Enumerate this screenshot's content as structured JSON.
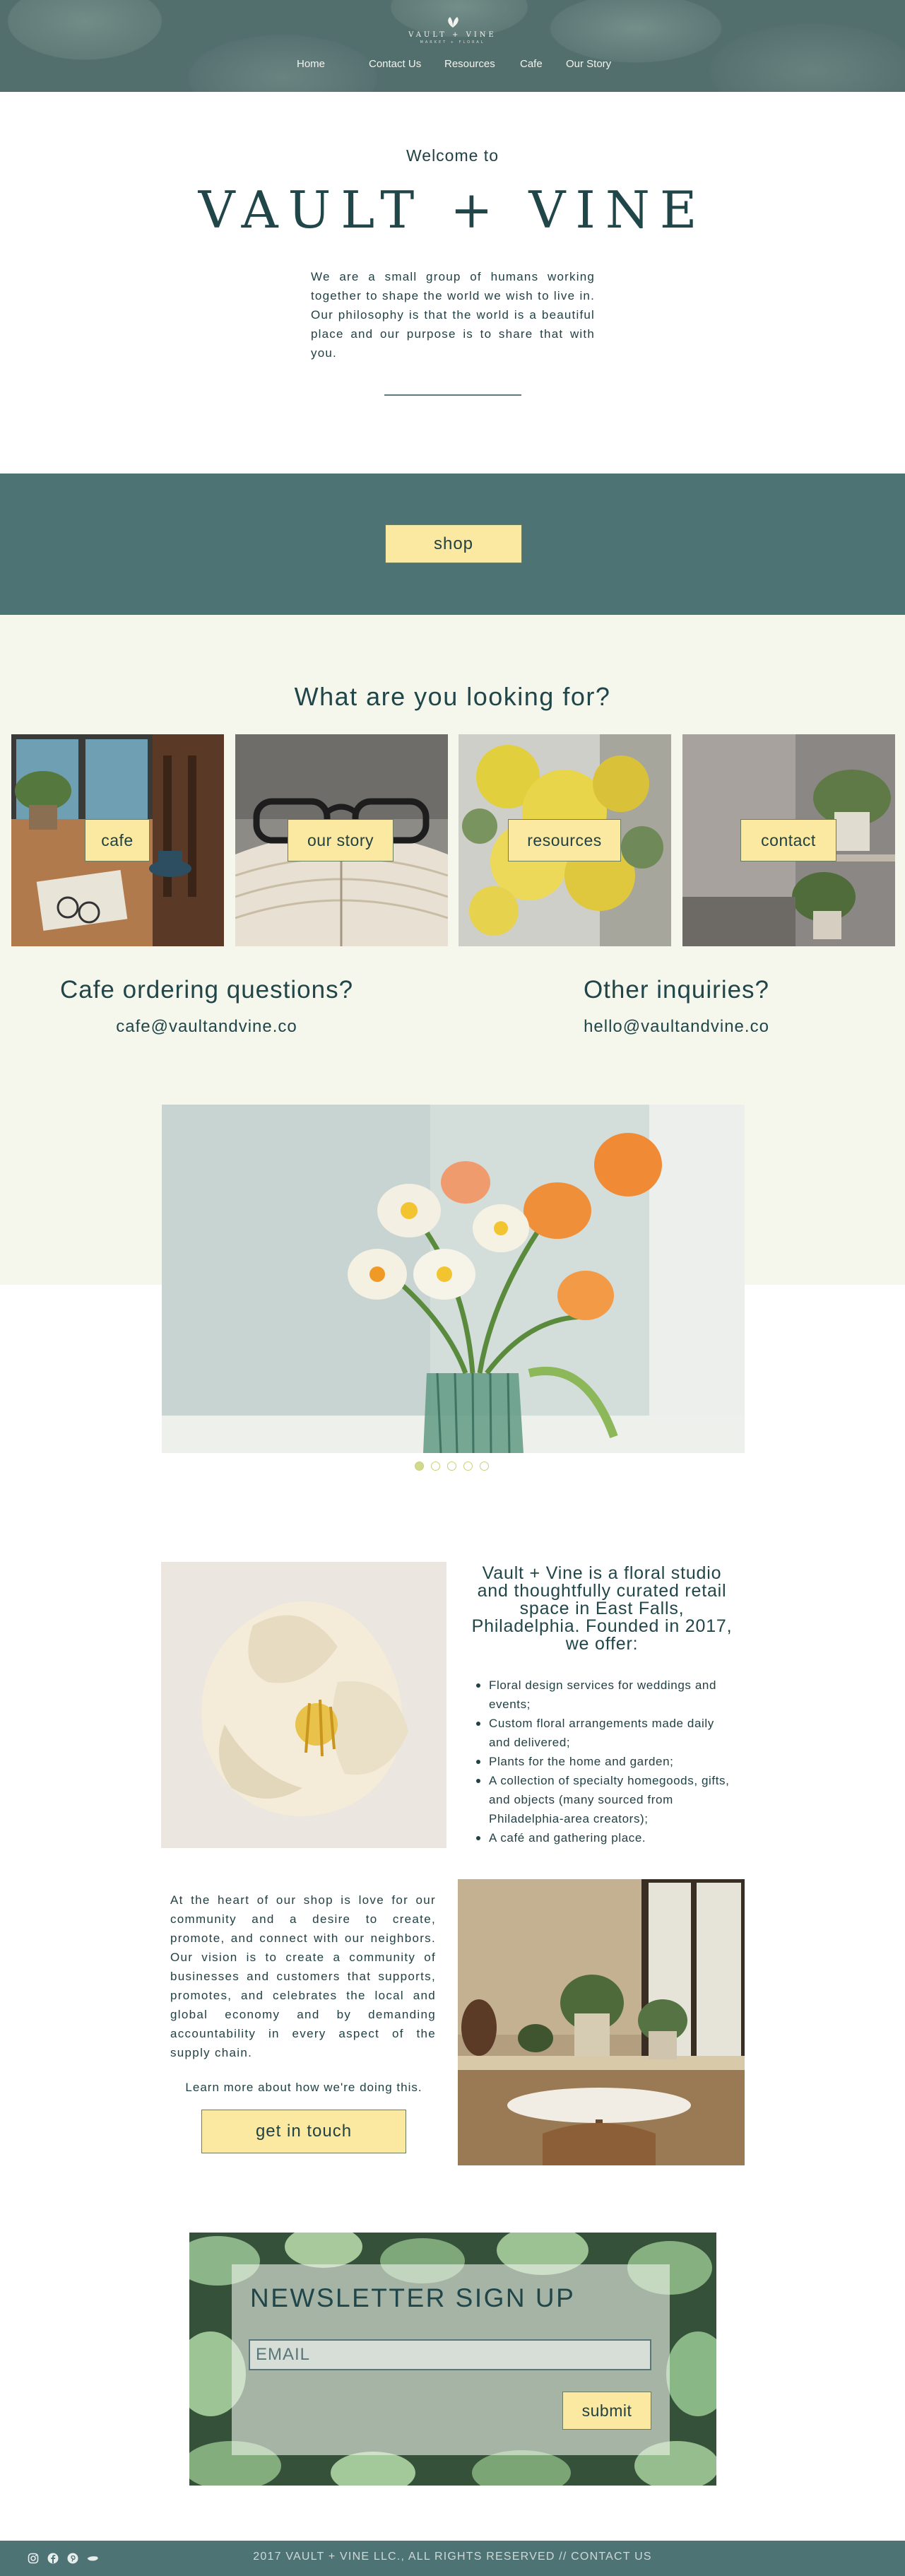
{
  "header": {
    "logo_name": "VAULT + VINE",
    "logo_sub": "MARKET + FLORAL",
    "nav": [
      {
        "label": "Home"
      },
      {
        "label": "Contact Us"
      },
      {
        "label": "Resources"
      },
      {
        "label": "Cafe"
      },
      {
        "label": "Our Story"
      }
    ]
  },
  "intro": {
    "welcome": "Welcome to",
    "title": "VAULT + VINE",
    "text": "We are a small group of humans working together to shape the world we wish to live in. Our philosophy is that the world is a beautiful place and our purpose is to share that with you."
  },
  "shop": {
    "label": "shop"
  },
  "looking": {
    "heading": "What are you looking for?",
    "tiles": [
      {
        "label": "cafe"
      },
      {
        "label": "our story"
      },
      {
        "label": "resources"
      },
      {
        "label": "contact"
      }
    ]
  },
  "contacts": {
    "cafe_heading": "Cafe ordering questions?",
    "cafe_email": "cafe@vaultandvine.co",
    "other_heading": "Other inquiries?",
    "other_email": "hello@vaultandvine.co"
  },
  "carousel": {
    "slides": 5,
    "active_index": 0
  },
  "about": {
    "heading": "Vault + Vine is a floral studio and thoughtfully curated retail space in East Falls, Philadelphia. Founded in 2017, we offer:",
    "offers": [
      "Floral design services for weddings and events;",
      "Custom floral arrangements made daily and delivered;",
      "Plants for the home and garden;",
      "A collection of specialty homegoods, gifts, and objects (many sourced from Philadelphia-area creators);",
      "A café and gathering place."
    ],
    "heart": "At the heart of our shop is love for our community and a desire to create, promote, and connect with our neighbors. Our vision is to create a community of businesses and customers that supports, promotes, and celebrates the local and global economy and by demanding accountability in every aspect of the supply chain.",
    "learn": "Learn more about how we're doing this.",
    "button": "get in touch"
  },
  "newsletter": {
    "heading": "NEWSLETTER SIGN UP",
    "email_placeholder": "EMAIL",
    "submit": "submit"
  },
  "footer": {
    "text": "2017 VAULT + VINE LLC., ALL RIGHTS RESERVED // CONTACT US",
    "icons": [
      "instagram-icon",
      "facebook-icon",
      "pinterest-icon",
      "yelp-icon"
    ]
  },
  "colors": {
    "teal": "#4e7375",
    "button_yellow": "#fbe9a1",
    "cream": "#f5f6ec",
    "text": "#214145"
  }
}
